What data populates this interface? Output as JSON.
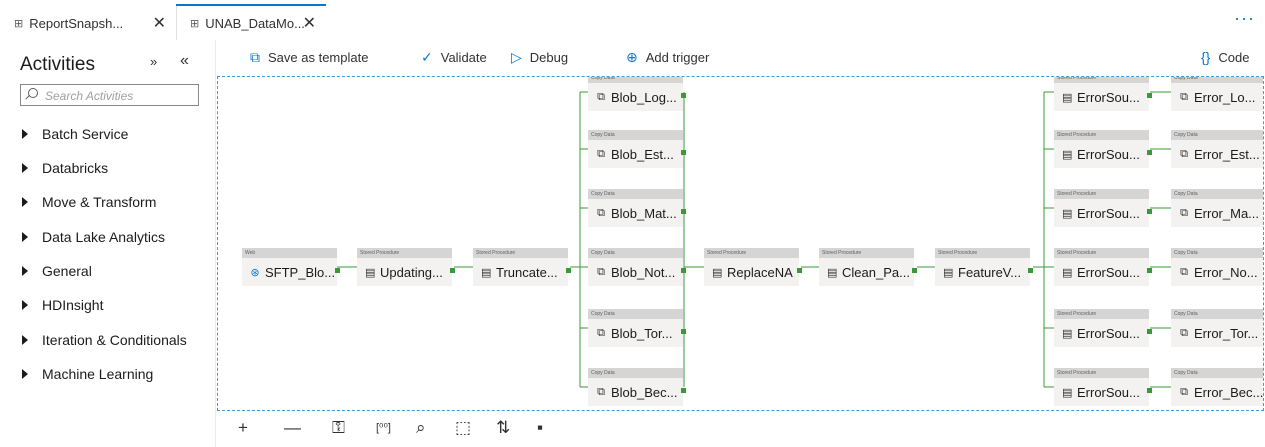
{
  "tabs": [
    {
      "label": "ReportSnapsh...",
      "close": "✕",
      "icon": "pipeline-icon"
    },
    {
      "label": "UNAB_DataMo...",
      "close": "✕",
      "icon": "pipeline-icon"
    }
  ],
  "more_label": "···",
  "sidebar": {
    "title": "Activities",
    "collapse_label": "»",
    "hide_label": "«",
    "search_placeholder": "Search Activities",
    "categories": [
      "Batch Service",
      "Databricks",
      "Move & Transform",
      "Data Lake Analytics",
      "General",
      "HDInsight",
      "Iteration & Conditionals",
      "Machine Learning"
    ]
  },
  "toolbar": {
    "save_template": "Save as template",
    "validate": "Validate",
    "debug": "Debug",
    "add_trigger": "Add trigger",
    "code": "Code"
  },
  "nodes": {
    "sftp": {
      "type": "Web",
      "label": "SFTP_Blo..."
    },
    "updating": {
      "type": "Stored Procedure",
      "label": "Updating..."
    },
    "truncate": {
      "type": "Stored Procedure",
      "label": "Truncate..."
    },
    "blob_log": {
      "type": "Copy Data",
      "label": "Blob_Log..."
    },
    "blob_est": {
      "type": "Copy Data",
      "label": "Blob_Est..."
    },
    "blob_mat": {
      "type": "Copy Data",
      "label": "Blob_Mat..."
    },
    "blob_not": {
      "type": "Copy Data",
      "label": "Blob_Not..."
    },
    "blob_tor": {
      "type": "Copy Data",
      "label": "Blob_Tor..."
    },
    "blob_bec": {
      "type": "Copy Data",
      "label": "Blob_Bec..."
    },
    "replacena": {
      "type": "Stored Procedure",
      "label": "ReplaceNA"
    },
    "clean": {
      "type": "Stored Procedure",
      "label": "Clean_Pa..."
    },
    "feature": {
      "type": "Stored Procedure",
      "label": "FeatureV..."
    },
    "errsou_1": {
      "type": "Stored Procedure",
      "label": "ErrorSou..."
    },
    "errsou_2": {
      "type": "Stored Procedure",
      "label": "ErrorSou..."
    },
    "errsou_3": {
      "type": "Stored Procedure",
      "label": "ErrorSou..."
    },
    "errsou_4": {
      "type": "Stored Procedure",
      "label": "ErrorSou..."
    },
    "errsou_5": {
      "type": "Stored Procedure",
      "label": "ErrorSou..."
    },
    "errsou_6": {
      "type": "Stored Procedure",
      "label": "ErrorSou..."
    },
    "error_lo": {
      "type": "Copy Data",
      "label": "Error_Lo..."
    },
    "error_est": {
      "type": "Copy Data",
      "label": "Error_Est..."
    },
    "error_ma": {
      "type": "Copy Data",
      "label": "Error_Ma..."
    },
    "error_no": {
      "type": "Copy Data",
      "label": "Error_No..."
    },
    "error_tor": {
      "type": "Copy Data",
      "label": "Error_Tor..."
    },
    "error_bec": {
      "type": "Copy Data",
      "label": "Error_Bec..."
    }
  },
  "zoom_controls": {
    "zoom_in": "+",
    "zoom_out": "—",
    "lock": "lock-icon",
    "zoom_100": "zoom-100-icon",
    "zoom_fit": "zoom-fit-icon",
    "select": "select-icon",
    "auto_align": "auto-align-icon",
    "layout": "layout-icon"
  },
  "colors": {
    "accent": "#0078d4",
    "link": "#3a9a3a",
    "node_header": "#d5d5d5",
    "node_body": "#f3f2f1"
  }
}
